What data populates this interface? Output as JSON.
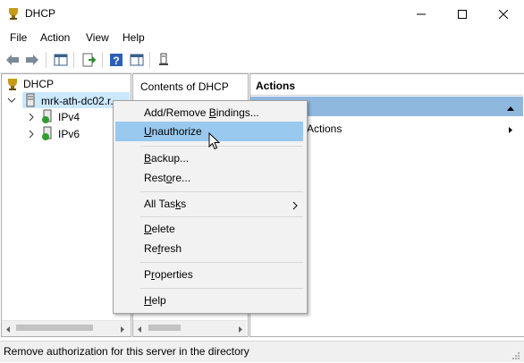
{
  "window": {
    "title": "DHCP",
    "minimize": "—",
    "maximize": "☐",
    "close": "✕"
  },
  "menu": [
    "File",
    "Action",
    "View",
    "Help"
  ],
  "tree": {
    "root": "DHCP",
    "server": "mrk-ath-dc02.r...",
    "children": [
      "IPv4",
      "IPv6"
    ]
  },
  "center": {
    "header": "Contents of DHCP"
  },
  "actions": {
    "header": "Actions",
    "section_item": "Actions"
  },
  "context_menu": {
    "items": [
      {
        "pre": "Add/Remove ",
        "ul": "B",
        "post": "indings..."
      },
      {
        "pre": "",
        "ul": "U",
        "post": "nauthorize"
      },
      {
        "pre": "",
        "ul": "B",
        "post": "ackup..."
      },
      {
        "pre": "Rest",
        "ul": "o",
        "post": "re..."
      },
      {
        "pre": "All Tas",
        "ul": "k",
        "post": "s"
      },
      {
        "pre": "",
        "ul": "D",
        "post": "elete"
      },
      {
        "pre": "Re",
        "ul": "f",
        "post": "resh"
      },
      {
        "pre": "P",
        "ul": "r",
        "post": "operties"
      },
      {
        "pre": "",
        "ul": "H",
        "post": "elp"
      }
    ]
  },
  "status": "Remove authorization for this server in the directory",
  "colors": {
    "highlight": "#99c9ef",
    "selection": "#cce8ff",
    "actions_bar": "#8fb8de"
  }
}
